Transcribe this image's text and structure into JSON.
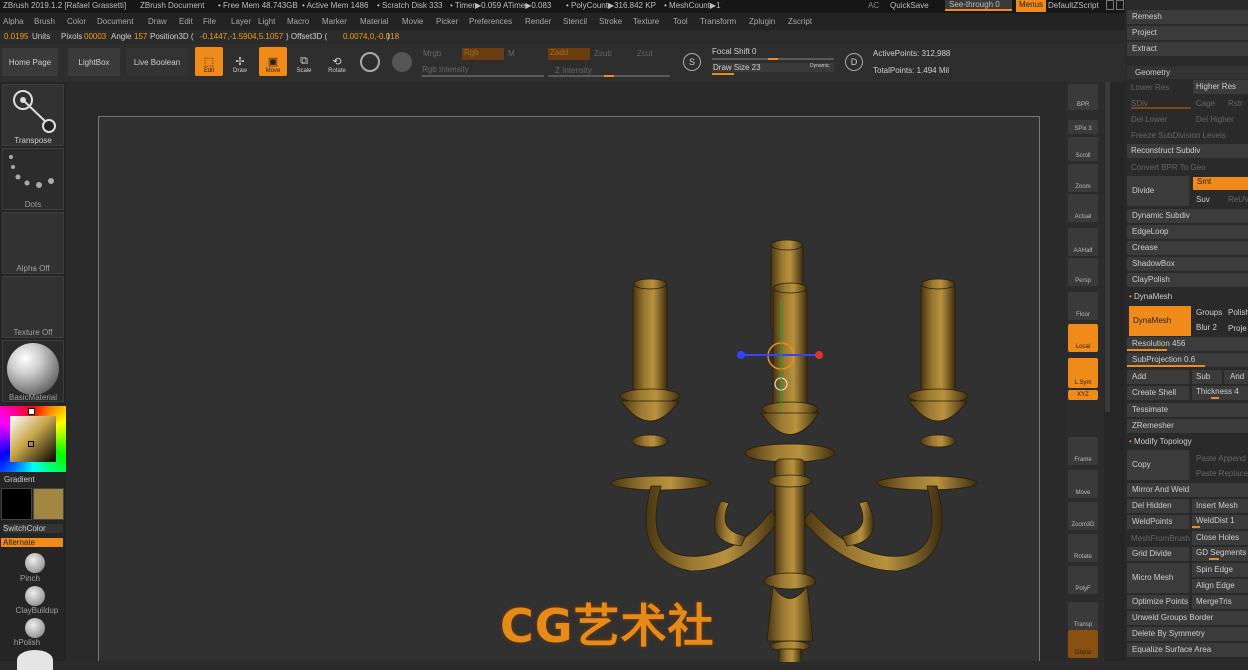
{
  "titlebar": {
    "app": "ZBrush 2019.1.2 [Rafael Grassetti]",
    "doc": "ZBrush Document",
    "free_mem": "• Free Mem 48.743GB",
    "active_mem": "• Active Mem 1486",
    "scratch": "• Scratch Disk 333",
    "timer": "• Timer▶0.059 ATime▶0.083",
    "polycount": "• PolyCount▶316.842 KP",
    "meshcount": "• MeshCount▶1",
    "ac": "AC",
    "quicksave": "QuickSave",
    "see_through": "See-through  0",
    "menus": "Menus",
    "script": "DefaultZScript"
  },
  "menu": [
    "Alpha",
    "Brush",
    "Color",
    "Document",
    "Draw",
    "Edit",
    "File",
    "Layer",
    "Light",
    "Macro",
    "Marker",
    "Material",
    "Movie",
    "Picker",
    "Preferences",
    "Render",
    "Stencil",
    "Stroke",
    "Texture",
    "Tool",
    "Transform",
    "Zplugin",
    "Zscript"
  ],
  "info": {
    "units_val": "0.0195",
    "units": "Units",
    "pixols": "Pixols",
    "pixols_val": "00003",
    "angle": "Angle",
    "angle_val": "157",
    "pos_label": "Position3D (",
    "pos_val": "-0.1447,-1.5904,5.1057",
    "offset_label": ") Offset3D (",
    "offset_val": "0.0074,0,-0.018",
    "end": ")"
  },
  "toolbar": {
    "home": "Home Page",
    "lightbox": "LightBox",
    "liveboolean": "Live Boolean",
    "edit": "Edit",
    "draw": "Draw",
    "move": "Move",
    "scale": "Scale",
    "rotate": "Rotate",
    "mrgb": "Mrgb",
    "rgb": "Rgb",
    "m": "M",
    "rgb_intensity": "Rgb Intensity",
    "zadd": "Zadd",
    "zsub": "Zsub",
    "zcut": "Zcut",
    "z_intensity": "Z Intensity",
    "focal_shift": "Focal Shift 0",
    "draw_size": "Draw Size 23",
    "dynamic": "Dynamic",
    "active_points": "ActivePoints: 312,988",
    "total_points": "TotalPoints: 1.494 Mil"
  },
  "left": {
    "transpose": "Transpose",
    "dots": "Dots",
    "alpha_off": "Alpha Off",
    "texture_off": "Texture Off",
    "material": "BasicMaterial",
    "gradient": "Gradient",
    "switchcolor": "SwitchColor",
    "alternate": "Alternate",
    "pinch": "Pinch",
    "claybuildup": "ClayBuildup",
    "hpolish": "hPolish"
  },
  "righttools": [
    "BPR",
    "SPix 3",
    "Scroll",
    "Zoom",
    "Actual",
    "AAHalf",
    "Persp",
    "Floor",
    "Local",
    "L.Sym",
    "Frame",
    "Move",
    "Zoom3D",
    "Rotate",
    "PolyF",
    "Transp",
    "Ghost"
  ],
  "rightpanel": {
    "remesh": "Remesh",
    "project": "Project",
    "extract": "Extract",
    "geometry": "Geometry",
    "lower_res": "Lower Res",
    "higher_res": "Higher Res",
    "sdiv": "SDiv",
    "cage": "Cage",
    "rstr": "Rstr",
    "del_lower": "Del Lower",
    "del_higher": "Del Higher",
    "freeze": "Freeze SubDivision Levels",
    "reconstruct": "Reconstruct Subdiv",
    "convert_bpr": "Convert BPR To Geo",
    "divide": "Divide",
    "smt": "Smt",
    "suv": "Suv",
    "reuv": "ReUV",
    "dynamic_subdiv": "Dynamic Subdiv",
    "edgeloop": "EdgeLoop",
    "crease": "Crease",
    "shadowbox": "ShadowBox",
    "claypolish": "ClayPolish",
    "dynamesh_hdr": "DynaMesh",
    "dynamesh": "DynaMesh",
    "groups": "Groups",
    "polish": "Polish",
    "blur": "Blur 2",
    "proje": "Proje",
    "resolution": "Resolution 456",
    "subprojection": "SubProjection 0.6",
    "add": "Add",
    "sub": "Sub",
    "and": "And",
    "create_shell": "Create Shell",
    "thickness": "Thickness 4",
    "tessimate": "Tessimate",
    "zremesher": "ZRemesher",
    "modify_topology": "Modify Topology",
    "copy": "Copy",
    "paste_append": "Paste Append",
    "paste_replace": "Paste Replace",
    "mirror_weld": "Mirror And Weld",
    "del_hidden": "Del Hidden",
    "insert_mesh": "Insert Mesh",
    "weldpoints": "WeldPoints",
    "welddist": "WeldDist 1",
    "meshfrombrush": "MeshFromBrush",
    "close_holes": "Close Holes",
    "grid_divide": "Grid Divide",
    "gd_segments": "GD Segments",
    "micro_mesh": "Micro Mesh",
    "spin_edge": "Spin Edge",
    "align_edge": "Align Edge",
    "optimize_points": "Optimize Points",
    "mergetris": "MergeTris",
    "unweld": "Unweld Groups Border",
    "delete_symmetry": "Delete By Symmetry",
    "equalize": "Equalize Surface Area"
  },
  "watermark": "CG艺术社",
  "colors": {
    "accent": "#f08a19",
    "bg": "#2b2b2b",
    "model": "#8a6a2a"
  }
}
